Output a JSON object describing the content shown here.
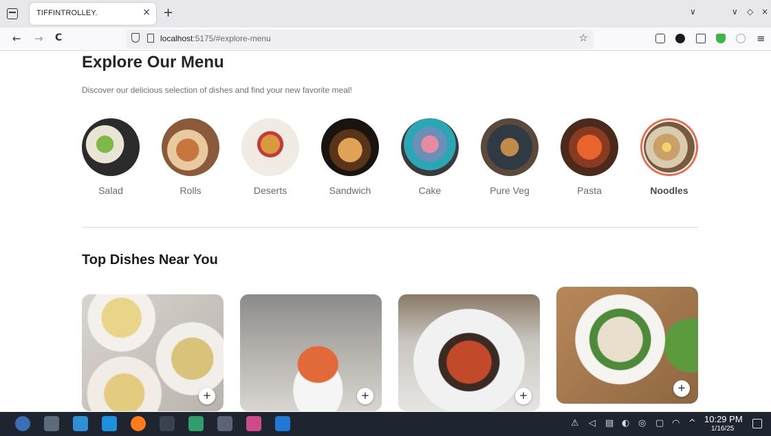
{
  "browser": {
    "tab_title": "TIFFINTROLLEY.",
    "tab_close": "×",
    "new_tab": "+",
    "url_host": "localhost",
    "url_path": ":5175/#explore-menu",
    "back": "←",
    "forward": "→",
    "reload": "C",
    "bookmark": "☆",
    "menu": "≡",
    "win_list": "∨",
    "win_minimize": "∨",
    "win_restore": "◇",
    "win_close": "×"
  },
  "explore": {
    "title": "Explore Our Menu",
    "subtitle": "Discover our delicious selection of dishes and find your new favorite meal!",
    "categories": [
      {
        "label": "Salad",
        "active": false
      },
      {
        "label": "Rolls",
        "active": false
      },
      {
        "label": "Deserts",
        "active": false
      },
      {
        "label": "Sandwich",
        "active": false
      },
      {
        "label": "Cake",
        "active": false
      },
      {
        "label": "Pure Veg",
        "active": false
      },
      {
        "label": "Pasta",
        "active": false
      },
      {
        "label": "Noodles",
        "active": true
      }
    ]
  },
  "top_dishes": {
    "title": "Top Dishes Near You",
    "add_label": "+"
  },
  "taskbar": {
    "time": "10:29 PM",
    "date": "1/16/25"
  },
  "colors": {
    "accent": "#ef6b4e",
    "taskbar": "#1e2530"
  }
}
